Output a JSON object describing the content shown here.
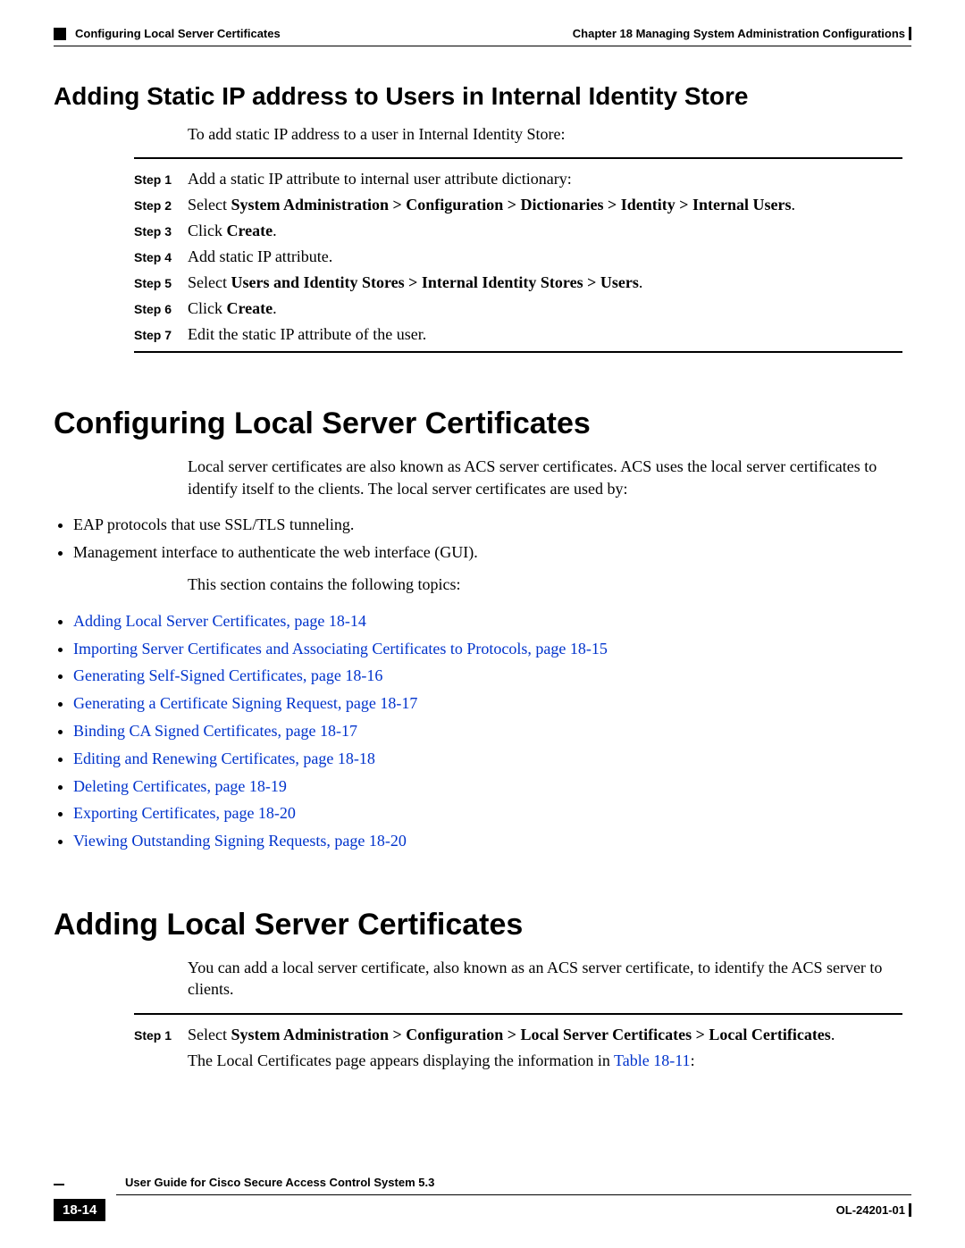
{
  "header": {
    "chapter": "Chapter 18    Managing System Administration Configurations",
    "section": "Configuring Local Server Certificates"
  },
  "s1": {
    "heading": "Adding Static IP address to Users in Internal Identity Store",
    "intro": "To add static IP address to a user in Internal Identity Store:",
    "steps": [
      {
        "label": "Step 1",
        "pre": "Add a static IP attribute to internal user attribute dictionary:",
        "bold": "",
        "post": ""
      },
      {
        "label": "Step 2",
        "pre": "Select ",
        "bold": "System Administration > Configuration > Dictionaries > Identity > Internal Users",
        "post": "."
      },
      {
        "label": "Step 3",
        "pre": "Click ",
        "bold": "Create",
        "post": "."
      },
      {
        "label": "Step 4",
        "pre": "Add static IP attribute.",
        "bold": "",
        "post": ""
      },
      {
        "label": "Step 5",
        "pre": "Select ",
        "bold": "Users and Identity Stores > Internal Identity Stores > Users",
        "post": "."
      },
      {
        "label": "Step 6",
        "pre": "Click ",
        "bold": "Create",
        "post": "."
      },
      {
        "label": "Step 7",
        "pre": "Edit the static IP attribute of the user.",
        "bold": "",
        "post": ""
      }
    ]
  },
  "s2": {
    "heading": "Configuring Local Server Certificates",
    "p1": "Local server certificates are also known as ACS server certificates. ACS uses the local server certificates to identify itself to the clients. The local server certificates are used by:",
    "uses": [
      "EAP protocols that use SSL/TLS tunneling.",
      "Management interface to authenticate the web interface (GUI)."
    ],
    "p2": "This section contains the following topics:",
    "topics": [
      "Adding Local Server Certificates, page 18-14",
      "Importing Server Certificates and Associating Certificates to Protocols, page 18-15",
      "Generating Self-Signed Certificates, page 18-16",
      "Generating a Certificate Signing Request, page 18-17",
      "Binding CA Signed Certificates, page 18-17",
      "Editing and Renewing Certificates, page 18-18",
      "Deleting Certificates, page 18-19",
      "Exporting Certificates, page 18-20",
      "Viewing Outstanding Signing Requests, page 18-20"
    ]
  },
  "s3": {
    "heading": "Adding Local Server Certificates",
    "p1": "You can add a local server certificate, also known as an ACS server certificate, to identify the ACS server to clients.",
    "step1": {
      "label": "Step 1",
      "pre": "Select ",
      "bold": "System Administration > Configuration > Local Server Certificates > Local Certificates",
      "post": "."
    },
    "p2_pre": "The Local Certificates page appears displaying the information in ",
    "p2_link": "Table 18-11",
    "p2_post": ":"
  },
  "footer": {
    "guide": "User Guide for Cisco Secure Access Control System 5.3",
    "page": "18-14",
    "docid": "OL-24201-01"
  }
}
